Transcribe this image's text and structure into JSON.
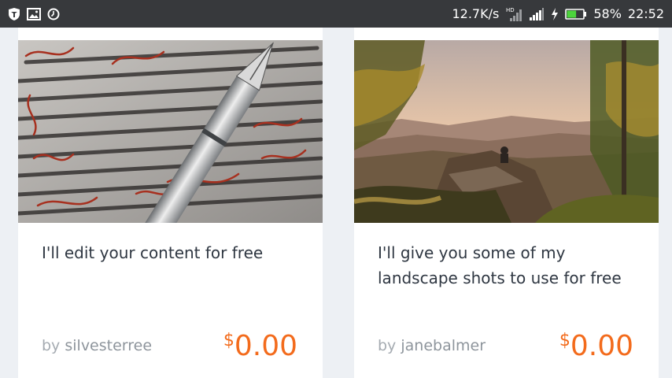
{
  "status_bar": {
    "network_speed": "12.7K/s",
    "battery_percent": "58%",
    "battery_level": 0.58,
    "time": "22:52",
    "left_icons": [
      "shield-notification-icon",
      "image-notification-icon",
      "clock-notification-icon"
    ],
    "right_icons": [
      "signal-hd-icon",
      "signal-bars-icon",
      "charging-bolt-icon",
      "battery-icon"
    ]
  },
  "cards": [
    {
      "title": "I'll edit your content for free",
      "by_label": "by",
      "author": "silvesterree",
      "currency": "$",
      "price": "0.00"
    },
    {
      "title": "I'll give you some of my landscape shots to use for free",
      "by_label": "by",
      "author": "janebalmer",
      "currency": "$",
      "price": "0.00"
    }
  ],
  "colors": {
    "status_bar": "#37393c",
    "background": "#edf0f4",
    "price": "#f36b1c",
    "title": "#2f3742",
    "author": "#8e959c",
    "battery_fill": "#4cd43c"
  }
}
